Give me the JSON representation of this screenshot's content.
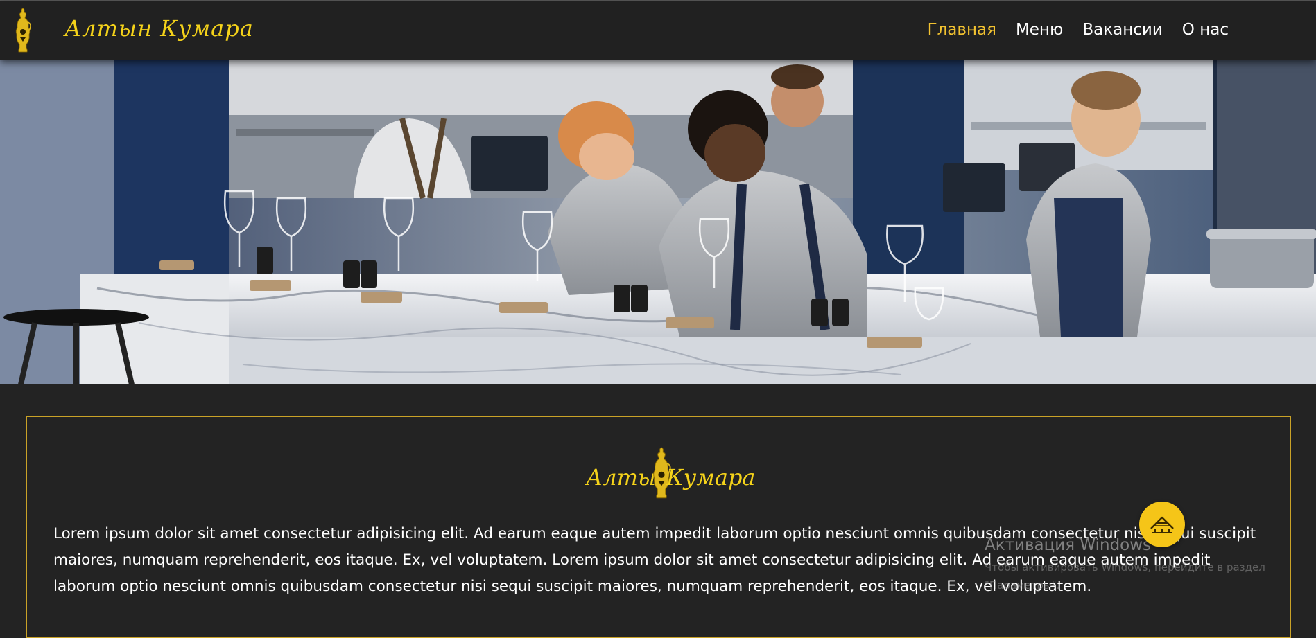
{
  "header": {
    "logo_text": "Алтын Кумара",
    "nav": [
      {
        "label": "Главная",
        "active": true
      },
      {
        "label": "Меню",
        "active": false
      },
      {
        "label": "Вакансии",
        "active": false
      },
      {
        "label": "О нас",
        "active": false
      }
    ]
  },
  "about": {
    "logo_word_1": "Алтын",
    "logo_word_2": "Кумара",
    "text": "Lorem ipsum dolor sit amet consectetur adipisicing elit. Ad earum eaque autem impedit laborum optio nesciunt omnis quibusdam consectetur nisi sequi suscipit maiores, numquam reprehenderit, eos itaque. Ex, vel voluptatem. Lorem ipsum dolor sit amet consectetur adipisicing elit. Ad earum eaque autem impedit laborum optio nesciunt omnis quibusdam consectetur nisi sequi suscipit maiores, numquam reprehenderit, eos itaque. Ex, vel voluptatem."
  },
  "watermark": {
    "title": "Активация Windows",
    "line1": "Чтобы активировать Windows, перейдите в раздел",
    "line2": "\"Параметры\"."
  },
  "colors": {
    "background": "#232323",
    "header": "#212121",
    "accent_gold": "#f4d21a",
    "active_nav": "#f2c230",
    "border": "#c9a227",
    "fab": "#f5c518"
  },
  "icons": {
    "header_logo": "golden-jug-icon",
    "about_logo": "golden-jug-icon",
    "fab": "yurt-roof-icon"
  }
}
